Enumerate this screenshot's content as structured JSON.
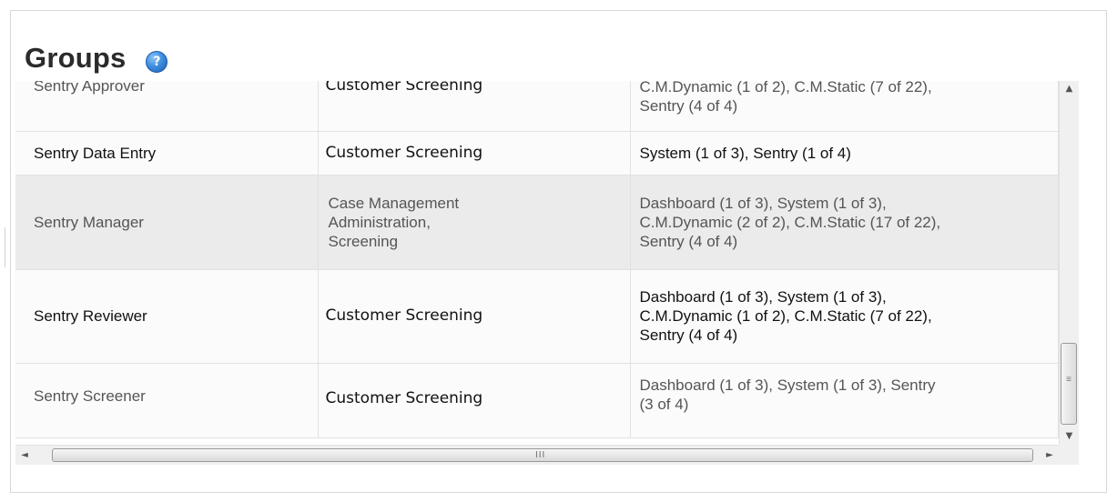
{
  "panel": {
    "title": "Groups",
    "help_icon_glyph": "?"
  },
  "groups_table": {
    "rows": [
      {
        "name": "Sentry Approver",
        "applications": [
          "Customer Screening"
        ],
        "permissions": [
          "C.M.Dynamic (1 of 2), C.M.Static (7 of 22),",
          "Sentry (4 of 4)"
        ]
      },
      {
        "name": "Sentry Data Entry",
        "applications": [
          "Customer Screening"
        ],
        "permissions": [
          "System (1 of 3), Sentry (1 of 4)"
        ]
      },
      {
        "name": "Sentry Manager",
        "applications": [
          "Case Management",
          "Administration,",
          "Screening"
        ],
        "permissions": [
          "Dashboard (1 of 3), System (1 of 3),",
          "C.M.Dynamic (2 of 2), C.M.Static (17 of 22),",
          "Sentry (4 of 4)"
        ]
      },
      {
        "name": "Sentry Reviewer",
        "applications": [
          "Customer Screening"
        ],
        "permissions": [
          "Dashboard (1 of 3), System (1 of 3),",
          "C.M.Dynamic (1 of 2), C.M.Static (7 of 22),",
          "Sentry (4 of 4)"
        ]
      },
      {
        "name": "Sentry Screener",
        "applications": [
          "Customer Screening"
        ],
        "permissions": [
          "Dashboard (1 of 3), System (1 of 3), Sentry",
          "(3 of 4)"
        ]
      }
    ]
  },
  "scrollbars": {
    "vertical": {
      "up_glyph": "▲",
      "down_glyph": "▼",
      "grip_glyph": "≡",
      "position": 0.95
    },
    "horizontal": {
      "left_glyph": "◄",
      "right_glyph": "►",
      "grip_glyph": "III",
      "position": 0.0
    }
  },
  "icons": {
    "help": "help-icon",
    "scroll_up": "arrow-up-icon",
    "scroll_down": "arrow-down-icon",
    "scroll_left": "arrow-left-icon",
    "scroll_right": "arrow-right-icon"
  }
}
